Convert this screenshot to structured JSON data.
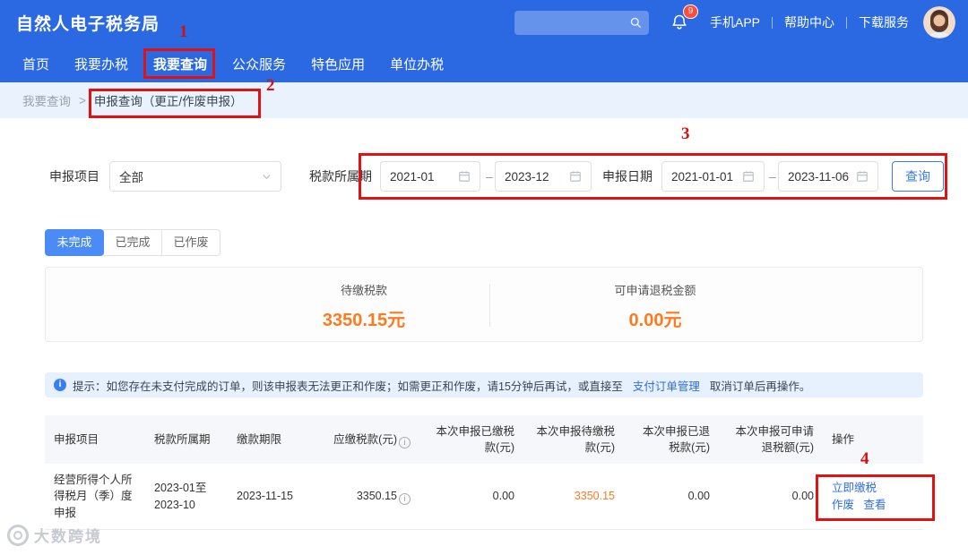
{
  "header": {
    "logo": "自然人电子税务局",
    "notification_badge": "9",
    "links": [
      {
        "label": "手机APP"
      },
      {
        "label": "帮助中心"
      },
      {
        "label": "下载服务"
      }
    ]
  },
  "nav": {
    "items": [
      {
        "label": "首页"
      },
      {
        "label": "我要办税"
      },
      {
        "label": "我要查询"
      },
      {
        "label": "公众服务"
      },
      {
        "label": "特色应用"
      },
      {
        "label": "单位办税"
      }
    ]
  },
  "breadcrumb": {
    "parent": "我要查询",
    "separator": ">",
    "current": "申报查询（更正/作废申报）"
  },
  "filters": {
    "project_label": "申报项目",
    "project_value": "全部",
    "period_label": "税款所属期",
    "period_start": "2021-01",
    "period_end": "2023-12",
    "date_label": "申报日期",
    "date_start": "2021-01-01",
    "date_end": "2023-11-06",
    "range_separator": "–",
    "query_button": "查询"
  },
  "tabs": [
    {
      "label": "未完成"
    },
    {
      "label": "已完成"
    },
    {
      "label": "已作废"
    }
  ],
  "summary": {
    "pending_label": "待缴税款",
    "pending_value": "3350.15元",
    "refund_label": "可申请退税金额",
    "refund_value": "0.00元"
  },
  "notice": {
    "prefix": "提示：如您存在未支付完成的订单，则该申报表无法更正和作废；如需更正和作废，请15分钟后再试，或直接至",
    "link": "支付订单管理",
    "suffix": "取消订单后再操作。"
  },
  "table": {
    "headers": [
      "申报项目",
      "税款所属期",
      "缴款期限",
      "应缴税款(元)",
      "本次申报已缴税款(元)",
      "本次申报待缴税款(元)",
      "本次申报已退税款(元)",
      "本次申报可申请退税额(元)",
      "操作"
    ],
    "rows": [
      {
        "project": "经营所得个人所得税月（季）度申报",
        "period": "2023-01至2023-10",
        "deadline": "2023-11-15",
        "payable": "3350.15",
        "paid": "0.00",
        "pending": "3350.15",
        "refunded": "0.00",
        "refundable": "0.00",
        "actions": [
          "立即缴税",
          "作废",
          "查看"
        ]
      }
    ]
  },
  "annotations": {
    "n1": "1",
    "n2": "2",
    "n3": "3",
    "n4": "4"
  },
  "watermark": "大数跨境",
  "colors": {
    "primary_blue": "#2a69e2",
    "active_tab_blue": "#4a8bf5",
    "accent_orange": "#ff7a1e",
    "link_blue": "#2e6de6",
    "annotation_red": "#e01212",
    "notice_bg": "#e7f1fd"
  }
}
